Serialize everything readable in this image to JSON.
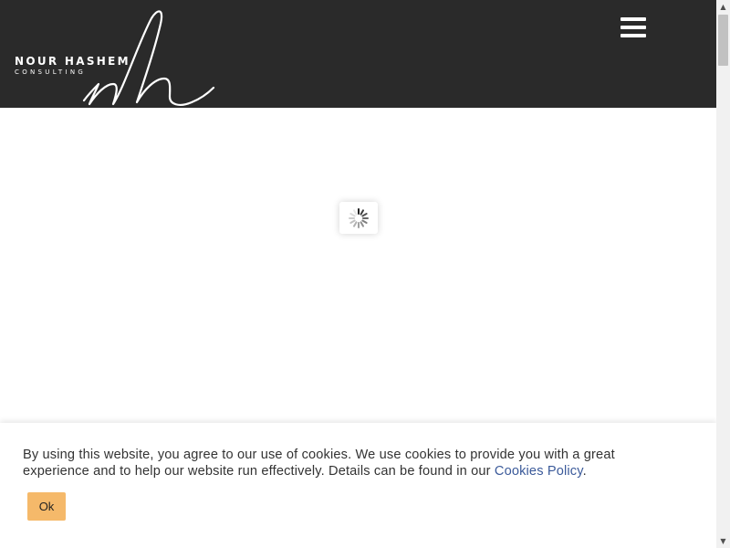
{
  "header": {
    "logo_name": "NOUR HASHEM",
    "logo_subtitle": "CONSULTING",
    "logo_monogram": "nh",
    "menu_icon": "hamburger-menu-icon"
  },
  "loader": {
    "icon": "spinner-icon"
  },
  "cookie_banner": {
    "text": "By using this website, you agree to our use of cookies. We use cookies to provide you with a great experience and to help our website run effectively. Details can be found in our ",
    "link_label": "Cookies Policy",
    "trailing": ".",
    "ok_label": "Ok"
  },
  "colors": {
    "header_background": "#2a2a2a",
    "ok_button": "#f5b96a",
    "link": "#3b5a9a"
  },
  "scrollbar": {
    "up_icon": "scroll-up-arrow-icon",
    "down_icon": "scroll-down-arrow-icon"
  }
}
